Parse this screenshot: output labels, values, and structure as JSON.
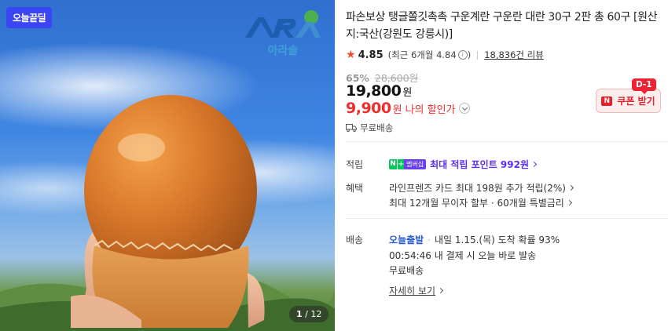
{
  "image": {
    "badge": "오늘끝딜",
    "logo_text": "아라솔",
    "page_current": "1",
    "page_total": "12"
  },
  "product": {
    "title": "파손보상 탱글쫄깃촉촉 구운계란 구운란 대란 30구 2판 총 60구 [원산지:국산(강원도 강릉시)]",
    "rating": "4.85",
    "rating_recent": "(최근 6개월 4.84",
    "review_count": "18,836건 리뷰",
    "discount_rate": "65%",
    "original_price": "28,600원",
    "price": "19,800",
    "price_unit": "원",
    "my_price": "9,900",
    "my_price_unit": "원",
    "my_price_label": "나의 할인가",
    "coupon_label": "쿠폰 받기",
    "coupon_badge": "D-1",
    "shipping_free": "무료배송"
  },
  "rows": {
    "points_label": "적립",
    "points_badge": "멤버십",
    "points_text": "최대 적립 포인트 992원",
    "benefit_label": "혜택",
    "benefit_1": "라인프렌즈 카드 최대 198원 추가 적립(2%)",
    "benefit_2": "최대 12개월 무이자 할부 · 60개월 특별금리",
    "delivery_label": "배송",
    "delivery_today": "오늘출발",
    "delivery_arrival": "내일 1.15.(목) 도착 확률 93%",
    "delivery_deadline": "00:54:46 내 결제 시 오늘 바로 발송",
    "delivery_fee": "무료배송",
    "details_link": "자세히 보기"
  },
  "colors": {
    "accent_red": "#f02d2d",
    "badge_blue": "#3b45f2",
    "naver_green": "#03c75a",
    "point_purple": "#5b2ff0",
    "today_blue": "#2a5bd7"
  }
}
